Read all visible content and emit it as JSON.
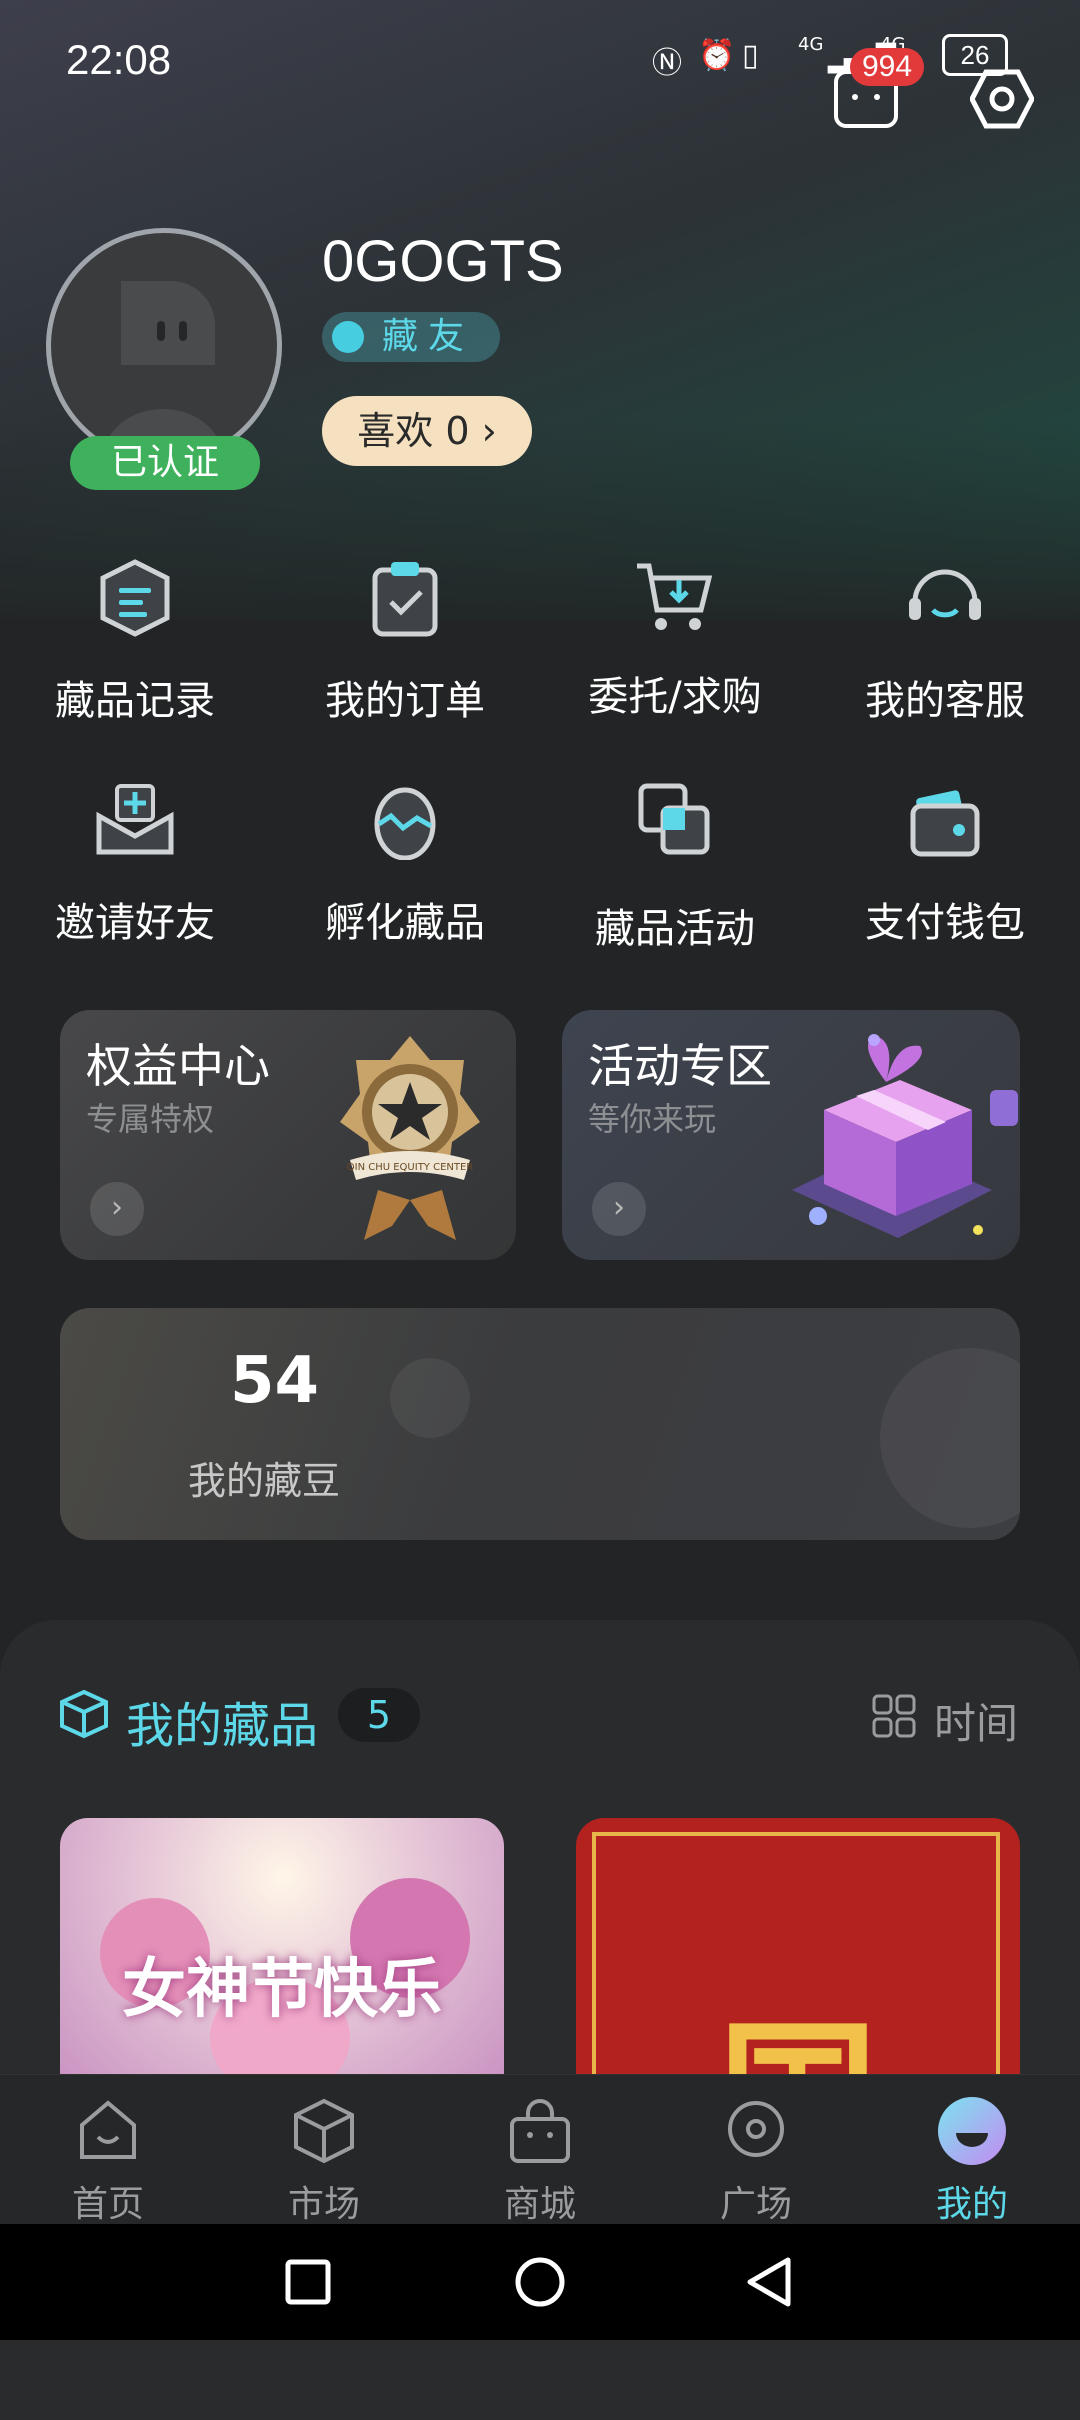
{
  "status_bar": {
    "time": "22:08",
    "battery": "26",
    "network_left": "4G",
    "network_right": "4G"
  },
  "header": {
    "message_badge": "994"
  },
  "profile": {
    "username": "0GOGTS",
    "role": "藏友",
    "verified_label": "已认证",
    "likes_label": "喜欢",
    "likes_count": "0",
    "likes_chevron": "›"
  },
  "grid": [
    {
      "label": "藏品记录",
      "icon": "collection-record-icon"
    },
    {
      "label": "我的订单",
      "icon": "order-clipboard-icon"
    },
    {
      "label": "委托/求购",
      "icon": "cart-icon"
    },
    {
      "label": "我的客服",
      "icon": "headset-icon"
    },
    {
      "label": "邀请好友",
      "icon": "invite-icon"
    },
    {
      "label": "孵化藏品",
      "icon": "egg-icon"
    },
    {
      "label": "藏品活动",
      "icon": "layers-icon"
    },
    {
      "label": "支付钱包",
      "icon": "wallet-icon"
    }
  ],
  "cards": {
    "equity": {
      "title": "权益中心",
      "subtitle": "专属特权",
      "arrow": "›",
      "emblem_text": "QIN CHU EQUITY CENTER"
    },
    "activity": {
      "title": "活动专区",
      "subtitle": "等你来玩",
      "arrow": "›"
    }
  },
  "beans": {
    "count": "54",
    "label": "我的藏豆"
  },
  "collection": {
    "title": "我的藏品",
    "count": "5",
    "sort_label": "时间"
  },
  "thumbnails": [
    {
      "text": "女神节快乐"
    },
    {
      "text": "国"
    }
  ],
  "bottom_nav": [
    {
      "label": "首页",
      "active": false
    },
    {
      "label": "市场",
      "active": false
    },
    {
      "label": "商城",
      "active": false
    },
    {
      "label": "广场",
      "active": false
    },
    {
      "label": "我的",
      "active": true
    }
  ],
  "colors": {
    "accent": "#5cd8e8",
    "verified": "#3fb15c",
    "likes_bg": "#f5e1bf",
    "badge": "#e23a3a"
  }
}
